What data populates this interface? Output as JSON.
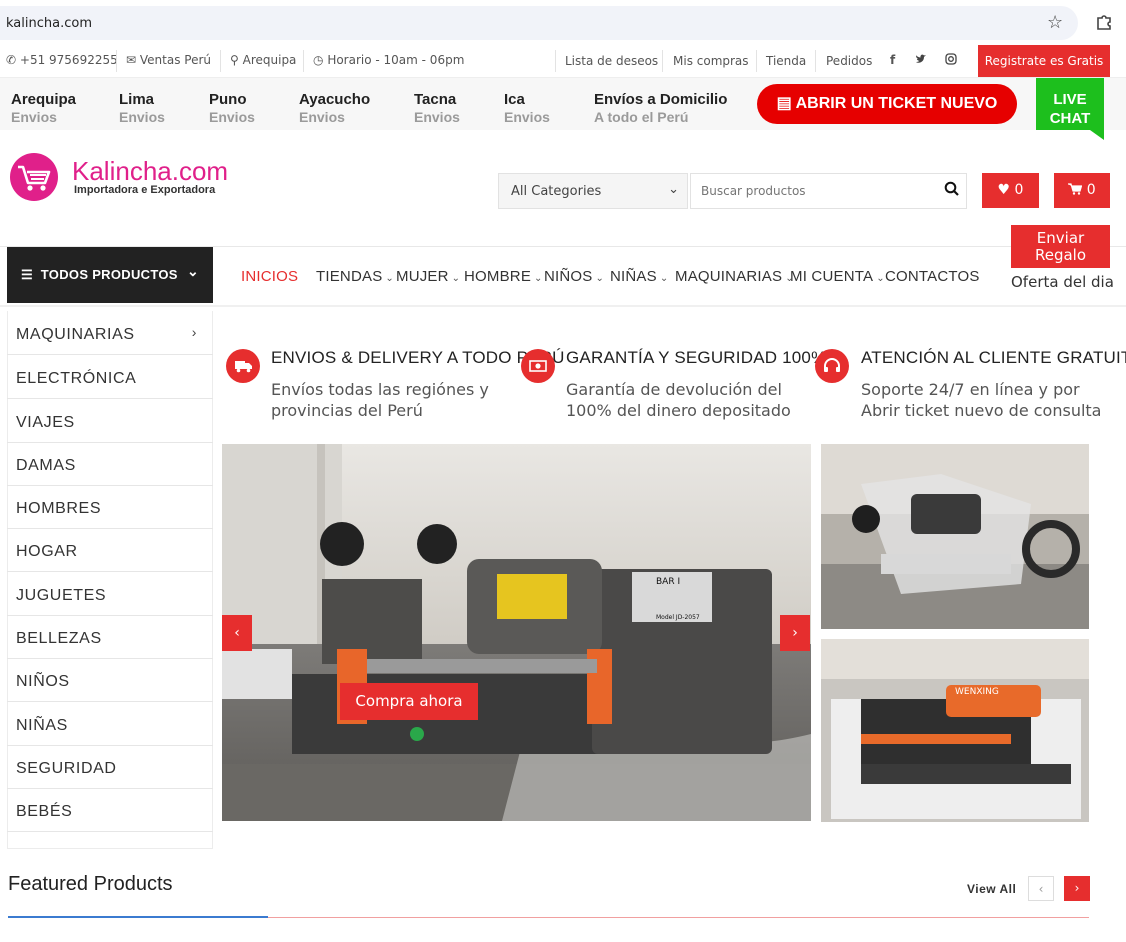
{
  "browser": {
    "url": "kalincha.com"
  },
  "topbar": {
    "phone": "+51 975692255",
    "sales": "Ventas Perú",
    "location": "Arequipa",
    "hours": "Horario - 10am - 06pm",
    "links": [
      "Lista de deseos",
      "Mis compras",
      "Tienda",
      "Pedidos"
    ],
    "register": "Registrate es Gratis"
  },
  "cities": [
    {
      "name": "Arequipa",
      "sub": "Envios"
    },
    {
      "name": "Lima",
      "sub": "Envios"
    },
    {
      "name": "Puno",
      "sub": "Envios"
    },
    {
      "name": "Ayacucho",
      "sub": "Envios"
    },
    {
      "name": "Tacna",
      "sub": "Envios"
    },
    {
      "name": "Ica",
      "sub": "Envios"
    },
    {
      "name": "Envíos a Domicilio",
      "sub": "A todo el Perú"
    }
  ],
  "ticket_button": "ABRIR UN TICKET NUEVO",
  "live_chat": {
    "line1": "LIVE",
    "line2": "CHAT"
  },
  "logo": {
    "name": "Kalincha.com",
    "tagline": "Importadora e Exportadora"
  },
  "search": {
    "category": "All Categories",
    "placeholder": "Buscar productos"
  },
  "wishlist_count": "0",
  "cart_count": "0",
  "nav": {
    "all_products": "TODOS PRODUCTOS",
    "items": [
      "INICIOS",
      "TIENDAS",
      "MUJER",
      "HOMBRE",
      "NIÑOS",
      "NIÑAS",
      "MAQUINARIAS",
      "MI CUENTA",
      "CONTACTOS"
    ],
    "gift_line1": "Enviar",
    "gift_line2": "Regalo",
    "offer": "Oferta del dia"
  },
  "sidebar": [
    "MAQUINARIAS",
    "ELECTRÓNICA",
    "VIAJES",
    "DAMAS",
    "HOMBRES",
    "HOGAR",
    "JUGUETES",
    "BELLEZAS",
    "NIÑOS",
    "NIÑAS",
    "SEGURIDAD",
    "BEBÉS"
  ],
  "features": [
    {
      "title": "ENVIOS & DELIVERY A TODO PERÚ",
      "line1": "Envíos todas las regiónes y",
      "line2": "provincias del Perú"
    },
    {
      "title": "GARANTÍA Y SEGURIDAD 100%",
      "line1": "Garantía de devolución del",
      "line2": "100% del dinero depositado"
    },
    {
      "title": "ATENCIÓN AL CLIENTE GRATUITA",
      "line1": "Soporte 24/7 en línea y por",
      "line2": "Abrir ticket nuevo de consulta"
    }
  ],
  "slider": {
    "buy_button": "Compra ahora",
    "label_top": "BAR I",
    "label_model": "Model JD-2057",
    "brand_label": "WENXING"
  },
  "featured": {
    "title": "Featured Products",
    "view_all": "View All"
  },
  "colors": {
    "accent": "#e62e2e",
    "brand": "#e0208a",
    "chat": "#1dbf1d"
  }
}
